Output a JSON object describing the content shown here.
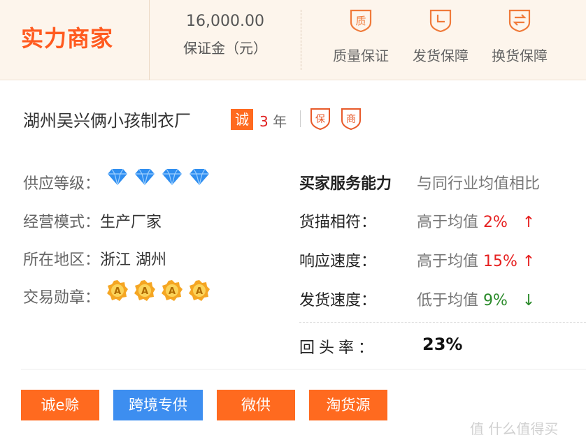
{
  "header": {
    "logo": "实力商家",
    "deposit_amount": "16,000.00",
    "deposit_label": "保证金（元）",
    "guarantees": [
      {
        "label": "质量保证",
        "icon": "quality-shield-icon"
      },
      {
        "label": "发货保障",
        "icon": "clock-shield-icon"
      },
      {
        "label": "换货保障",
        "icon": "exchange-shield-icon"
      }
    ]
  },
  "company": {
    "name": "湖州吴兴俩小孩制衣厂",
    "cheng_badge": "诚",
    "years_num": "3",
    "years_unit": "年",
    "badges": [
      "保",
      "商"
    ]
  },
  "info": {
    "supply_level_label": "供应等级：",
    "supply_level_diamonds": 4,
    "mode_label": "经营模式：",
    "mode_value": "生产厂家",
    "region_label": "所在地区：",
    "region_value": "浙江 湖州",
    "medals_label": "交易勋章：",
    "medals_count": 4
  },
  "service": {
    "title": "买家服务能力",
    "compare_title": "与同行业均值相比",
    "rows": [
      {
        "label": "货描相符：",
        "text": "高于均值",
        "pct": "2%",
        "arrow": "↑",
        "dir": "up"
      },
      {
        "label": "响应速度：",
        "text": "高于均值",
        "pct": "15%",
        "arrow": "↑",
        "dir": "up"
      },
      {
        "label": "发货速度：",
        "text": "低于均值",
        "pct": "9%",
        "arrow": "↓",
        "dir": "down"
      }
    ],
    "repeat_label": "回头率：",
    "repeat_value": "23%"
  },
  "buttons": [
    {
      "label": "诚e赊",
      "color": "#ff6a1f"
    },
    {
      "label": "跨境专供",
      "color": "#3d8ef0"
    },
    {
      "label": "微供",
      "color": "#ff6a1f"
    },
    {
      "label": "淘货源",
      "color": "#ff6a1f"
    }
  ],
  "watermark": "值 什么值得买",
  "colors": {
    "accent": "#ff5a1f",
    "up": "#e62020",
    "down": "#2a8a2a",
    "diamond": "#2f8ef0",
    "medal": "#f5a623"
  }
}
